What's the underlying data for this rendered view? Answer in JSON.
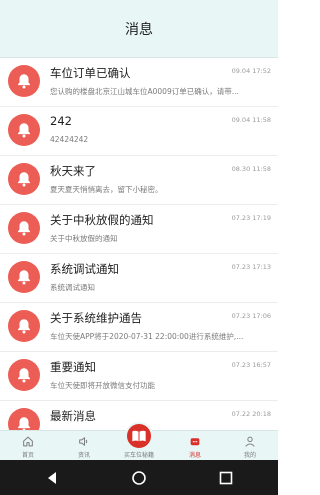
{
  "header": {
    "title": "消息"
  },
  "messages": [
    {
      "title": "车位订单已确认",
      "time": "09.04 17:52",
      "body": "您认购的楼盘北京江山城车位A0009订单已确认，请带..."
    },
    {
      "title": "242",
      "time": "09.04 11:58",
      "body": "42424242"
    },
    {
      "title": "秋天来了",
      "time": "08.30 11:58",
      "body": "夏天夏天悄悄离去，留下小秘密。"
    },
    {
      "title": "关于中秋放假的通知",
      "time": "07.23 17:19",
      "body": "关于中秋放假的通知"
    },
    {
      "title": "系统调试通知",
      "time": "07.23 17:13",
      "body": "系统调试通知"
    },
    {
      "title": "关于系统维护通告",
      "time": "07.23 17:06",
      "body": "车位天使APP将于2020-07-31 22:00:00进行系统维护,..."
    },
    {
      "title": "重要通知",
      "time": "07.23 16:57",
      "body": "车位天使即将开放微信支付功能"
    },
    {
      "title": "最新消息",
      "time": "07.22 20:18",
      "body": ""
    }
  ],
  "tabbar": {
    "home": "首页",
    "news": "资讯",
    "center": "买车位秘籍",
    "messages": "消息",
    "mine": "我的",
    "active": "messages"
  },
  "colors": {
    "accent": "#d9302a",
    "avatar": "#ec5d56",
    "header_bg": "#e8f6f6"
  }
}
